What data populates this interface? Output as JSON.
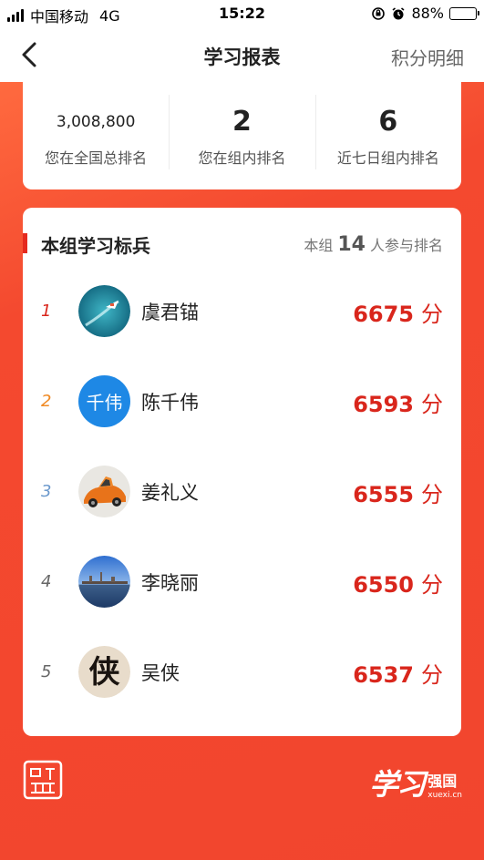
{
  "status_bar": {
    "carrier": "中国移动",
    "network": "4G",
    "time": "15:22",
    "battery": "88%",
    "battery_level": 0.88
  },
  "nav": {
    "title": "学习报表",
    "right_link": "积分明细"
  },
  "stats": [
    {
      "value": "3,008,800",
      "label": "您在全国总排名"
    },
    {
      "value": "2",
      "label": "您在组内排名"
    },
    {
      "value": "6",
      "label": "近七日组内排名"
    }
  ],
  "ranking": {
    "title": "本组学习标兵",
    "meta_prefix": "本组",
    "meta_count": "14",
    "meta_suffix": "人参与排名",
    "score_unit": "分",
    "rows": [
      {
        "rank": "1",
        "name": "虞君锚",
        "score": "6675",
        "avatar": "boat-photo",
        "rank_color": "#d9261c"
      },
      {
        "rank": "2",
        "name": "陈千伟",
        "score": "6593",
        "avatar_text": "千伟",
        "avatar_color": "#1e88e5",
        "rank_color": "#f08a24"
      },
      {
        "rank": "3",
        "name": "姜礼义",
        "score": "6555",
        "avatar": "car-photo",
        "rank_color": "#6a98cc"
      },
      {
        "rank": "4",
        "name": "李晓丽",
        "score": "6550",
        "avatar": "lake-photo",
        "rank_color": "#666666"
      },
      {
        "rank": "5",
        "name": "吴侠",
        "score": "6537",
        "avatar": "calligraphy-photo",
        "avatar_char": "侠",
        "rank_color": "#666666"
      }
    ]
  },
  "footer": {
    "brand_script": "学习",
    "brand_name": "强国",
    "brand_domain": "xuexi.cn"
  },
  "colors": {
    "accent": "#d9261c",
    "background": "#f2492f",
    "avatar_blue": "#1e88e5"
  }
}
